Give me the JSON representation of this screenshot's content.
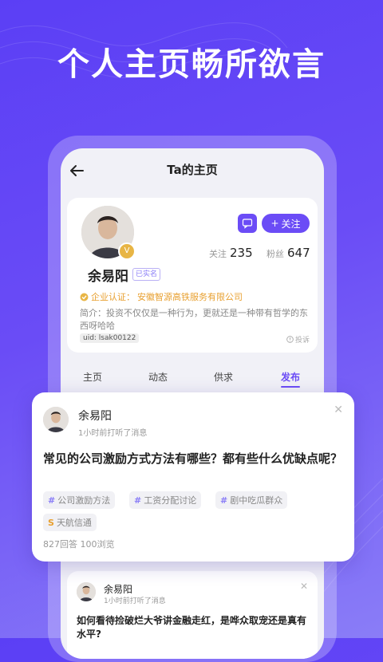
{
  "headline": "个人主页畅所欲言",
  "nav": {
    "title": "Ta的主页"
  },
  "profile": {
    "follow_label": "关注",
    "following_label": "关注",
    "following_count": "235",
    "fans_label": "粉丝",
    "fans_count": "647",
    "name": "余易阳",
    "realname_tag": "已实名",
    "cert_label": "企业认证：",
    "cert_company": "安徽智源高铁服务有限公司",
    "bio": "简介：投资不仅仅是一种行为，更就还是一种带有哲学的东西呀哈哈",
    "uid": "uid: lsak00122",
    "report_label": "投诉"
  },
  "tabs": [
    {
      "label": "主页"
    },
    {
      "label": "动态"
    },
    {
      "label": "供求"
    },
    {
      "label": "发布"
    }
  ],
  "post": {
    "author": "余易阳",
    "time": "1小时前打听了消息",
    "question": "常见的公司激励方式方法有哪些？都有些什么优缺点呢？",
    "tags": [
      "公司激励方法",
      "工资分配讨论",
      "剧中吃瓜群众"
    ],
    "coin_tag": "天航信通",
    "stats": "827回答 100浏览"
  },
  "post_small": {
    "author": "余易阳",
    "time": "1小时前打听了消息",
    "question": "如何看待捡破烂大爷讲金融走红，是哗众取宠还是真有水平?"
  },
  "colors": {
    "accent": "#6b4cf6",
    "gold": "#e8a030",
    "bg_start": "#5b3ff5"
  }
}
